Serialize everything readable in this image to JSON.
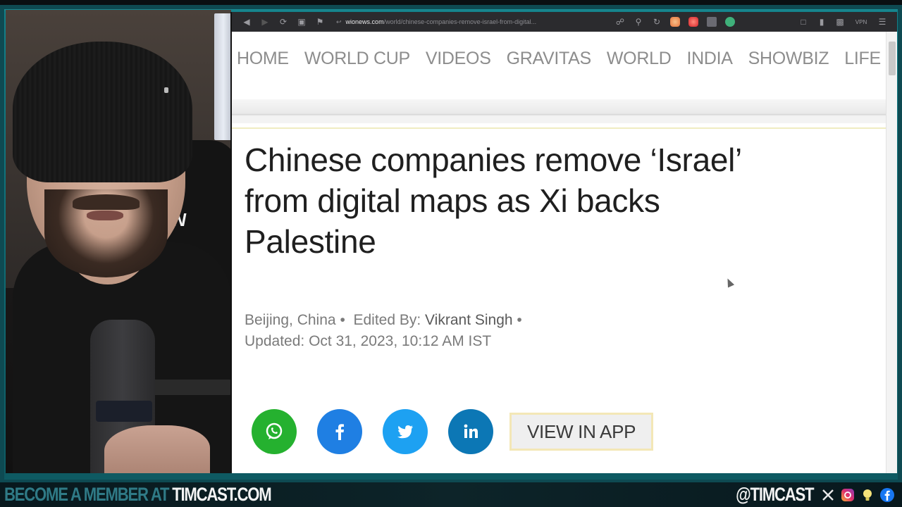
{
  "browser": {
    "url_domain": "wionews.com",
    "url_path": "/world/chinese-companies-remove-israel-from-digital...",
    "toolbar_icons": [
      "back-icon",
      "forward-icon",
      "reload-icon",
      "wallet-icon",
      "bookmark-icon"
    ],
    "extension_icons": [
      "brave-shield-icon",
      "brave-rewards-icon",
      "extension-puzzle-icon",
      "extension-green-icon"
    ],
    "right_icons": [
      "sidebar-icon",
      "wallet-icon",
      "screenshot-icon",
      "vpn-icon",
      "menu-icon"
    ],
    "vpn_label": "VPN"
  },
  "site": {
    "nav": [
      "HOME",
      "WORLD CUP",
      "VIDEOS",
      "GRAVITAS",
      "WORLD",
      "INDIA",
      "SHOWBIZ",
      "LIFE"
    ]
  },
  "article": {
    "headline": "Chinese companies remove ‘Israel’ from digital maps as Xi backs Palestine",
    "location": "Beijing, China",
    "edited_by_label": "Edited By:",
    "author": "Vikrant Singh",
    "separator": "•",
    "updated": "Updated: Oct 31, 2023, 10:12 AM IST",
    "share": [
      {
        "name": "whatsapp",
        "color": "#25b12f"
      },
      {
        "name": "facebook",
        "color": "#1f7fe3"
      },
      {
        "name": "twitter",
        "color": "#1da1f2"
      },
      {
        "name": "linkedin",
        "color": "#0c77b5"
      }
    ],
    "view_in_app": "VIEW IN APP"
  },
  "webcam": {
    "chair_logo": "N"
  },
  "banner": {
    "left_muted": "BECOME A MEMBER AT ",
    "left_bright": "TIMCAST.COM",
    "handle": "@TIMCAST",
    "socials": [
      "x-icon",
      "instagram-icon",
      "lightbulb-icon",
      "facebook-icon"
    ]
  }
}
